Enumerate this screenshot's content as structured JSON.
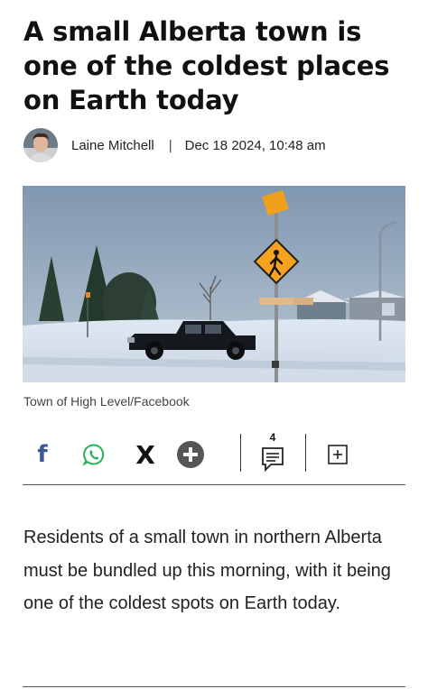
{
  "article": {
    "headline": "A small Alberta town is one of the coldest places on Earth today",
    "author": "Laine Mitchell",
    "separator": "|",
    "date": "Dec 18 2024, 10:48 am",
    "image_caption": "Town of High Level/Facebook",
    "body": "Residents of a small town in northern Alberta must be bundled up this morning, with it being one of the coldest spots on Earth today."
  },
  "share_bar": {
    "facebook_label": "f",
    "x_label": "X",
    "comment_count": "4",
    "icons": [
      "facebook-icon",
      "whatsapp-icon",
      "x-icon",
      "more-share-icon",
      "comment-icon",
      "bookmark-add-icon"
    ]
  },
  "colors": {
    "facebook": "#3b5998",
    "whatsapp": "#25b05a",
    "text": "#111111",
    "sky": "#8fa3b8",
    "sign_orange": "#f5a21e"
  }
}
